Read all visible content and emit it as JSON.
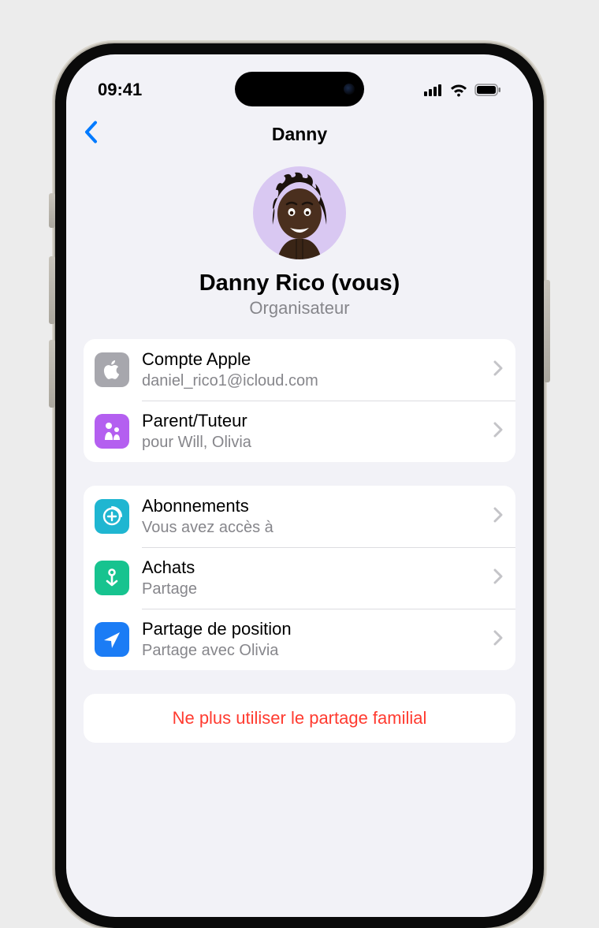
{
  "status": {
    "time": "09:41"
  },
  "nav": {
    "title": "Danny"
  },
  "profile": {
    "name": "Danny Rico (vous)",
    "role": "Organisateur"
  },
  "group1": [
    {
      "icon": "apple",
      "color": "#a7a7ad",
      "label": "Compte Apple",
      "sub": "daniel_rico1@icloud.com"
    },
    {
      "icon": "family",
      "color": "#b45ff0",
      "label": "Parent/Tuteur",
      "sub": "pour Will, Olivia"
    }
  ],
  "group2": [
    {
      "icon": "plus-clock",
      "color": "#1fb6d1",
      "label": "Abonnements",
      "sub": "Vous avez accès à"
    },
    {
      "icon": "purchase-arrow",
      "color": "#17c38f",
      "label": "Achats",
      "sub": "Partage"
    },
    {
      "icon": "location",
      "color": "#1b7cf5",
      "label": "Partage de position",
      "sub": "Partage avec Olivia"
    }
  ],
  "danger": {
    "label": "Ne plus utiliser le partage familial"
  }
}
